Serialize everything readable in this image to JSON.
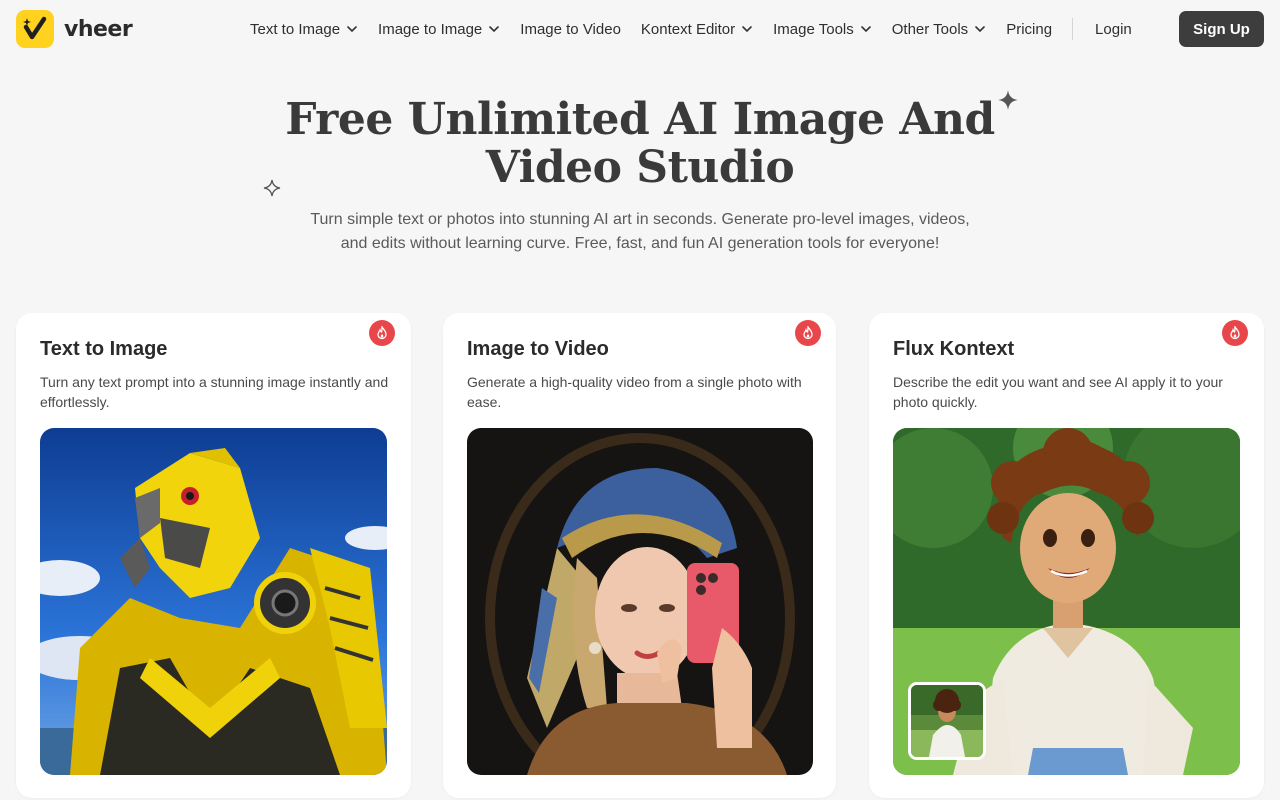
{
  "brand": {
    "name": "vheer",
    "accent": "#ffd21f"
  },
  "nav": {
    "items": [
      {
        "label": "Text to Image",
        "dropdown": true
      },
      {
        "label": "Image to Image",
        "dropdown": true
      },
      {
        "label": "Image to Video",
        "dropdown": false
      },
      {
        "label": "Kontext Editor",
        "dropdown": true
      },
      {
        "label": "Image Tools",
        "dropdown": true
      },
      {
        "label": "Other Tools",
        "dropdown": true
      },
      {
        "label": "Pricing",
        "dropdown": false
      }
    ],
    "login": "Login",
    "signup": "Sign Up"
  },
  "hero": {
    "title_line1": "Free Unlimited AI Image And",
    "title_line2": "Video Studio",
    "subtitle": "Turn simple text or photos into stunning AI art in seconds. Generate pro-level images, videos, and edits without learning curve. Free, fast, and fun AI generation tools for everyone!"
  },
  "cards": [
    {
      "title": "Text to Image",
      "description": "Turn any text prompt into a stunning image instantly and effortlessly.",
      "badge_icon": "flame-icon",
      "badge_color": "#e8464a"
    },
    {
      "title": "Image to Video",
      "description": "Generate a high-quality video from a single photo with ease.",
      "badge_icon": "flame-icon",
      "badge_color": "#e8464a"
    },
    {
      "title": "Flux Kontext",
      "description": "Describe the edit you want and see AI apply it to your photo quickly.",
      "badge_icon": "flame-icon",
      "badge_color": "#e8464a"
    }
  ]
}
